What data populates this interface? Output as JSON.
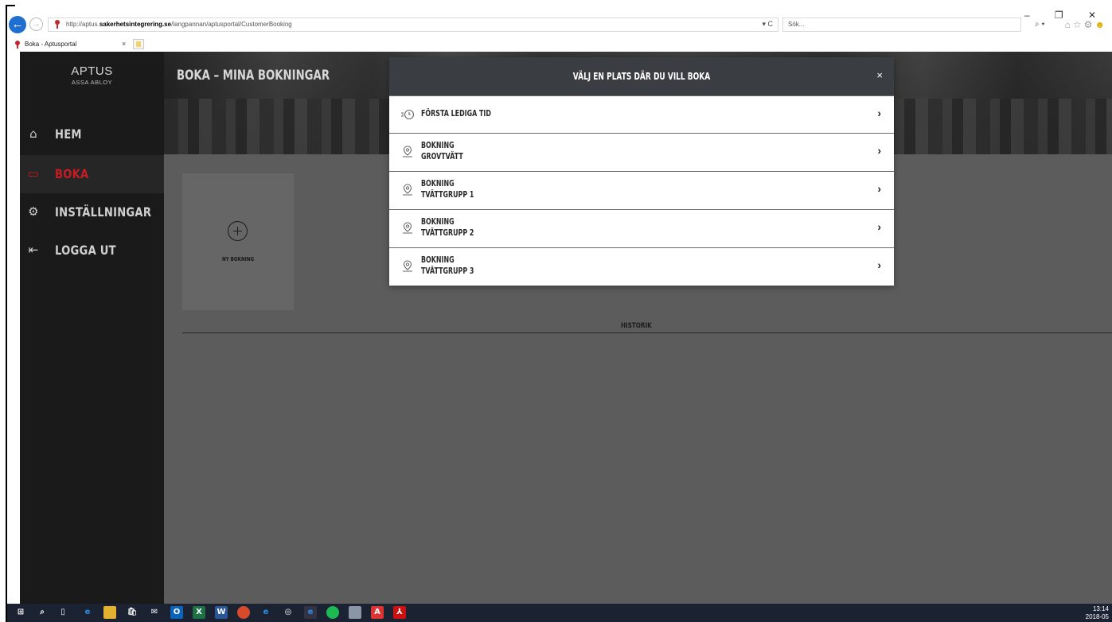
{
  "browser": {
    "url_prefix": "http://aptus.",
    "url_domain": "sakerhetsintegrering.se",
    "url_path": "/langpannan/aptusportal/CustomerBooking",
    "addr_tools": "▾ C",
    "search_placeholder": "Sök...",
    "tab_title": "Boka - Aptusportal",
    "tab_close": "×",
    "window_controls": "– ❐ ✕",
    "search_dropdown": "⌕ ▾"
  },
  "sidebar": {
    "logo_main": "APTUS",
    "logo_sub": "ASSA ABLOY",
    "items": [
      {
        "label": "HEM",
        "icon": "home-icon",
        "glyph": "⌂"
      },
      {
        "label": "BOKA",
        "icon": "calendar-icon",
        "glyph": "▭"
      },
      {
        "label": "INSTÄLLNINGAR",
        "icon": "gear-icon",
        "glyph": "⚙"
      },
      {
        "label": "LOGGA UT",
        "icon": "logout-icon",
        "glyph": "⇤"
      }
    ],
    "active_index": 1,
    "active_color": "#c41e24"
  },
  "page": {
    "title": "BOKA – MINA BOKNINGAR",
    "new_booking_label": "NY BOKNING",
    "history_label": "HISTORIK"
  },
  "modal": {
    "title": "VÄLJ EN PLATS DÄR DU VILL BOKA",
    "close": "×",
    "options": [
      {
        "line1": "FÖRSTA LEDIGA TID",
        "line2": "",
        "icon": "clock-icon"
      },
      {
        "line1": "BOKNING",
        "line2": "GROVTVÄTT",
        "icon": "location-pin-icon"
      },
      {
        "line1": "BOKNING",
        "line2": "TVÄTTGRUPP 1",
        "icon": "location-pin-icon"
      },
      {
        "line1": "BOKNING",
        "line2": "TVÄTTGRUPP 2",
        "icon": "location-pin-icon"
      },
      {
        "line1": "BOKNING",
        "line2": "TVÄTTGRUPP 3",
        "icon": "location-pin-icon"
      }
    ],
    "chevron": "›"
  },
  "taskbar": {
    "time": "13:14",
    "date": "2018-05"
  }
}
